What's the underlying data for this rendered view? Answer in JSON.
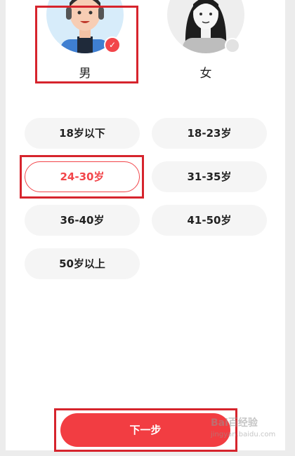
{
  "gender": {
    "male_label": "男",
    "female_label": "女",
    "selected": "male"
  },
  "age_options": [
    {
      "label": "18岁以下",
      "selected": false
    },
    {
      "label": "18-23岁",
      "selected": false
    },
    {
      "label": "24-30岁",
      "selected": true
    },
    {
      "label": "31-35岁",
      "selected": false
    },
    {
      "label": "36-40岁",
      "selected": false
    },
    {
      "label": "41-50岁",
      "selected": false
    },
    {
      "label": "50岁以上",
      "selected": false
    }
  ],
  "footer": {
    "next_label": "下一步"
  },
  "watermark": {
    "brand": "Bai百经验",
    "url": "jingyan.baidu.com"
  },
  "colors": {
    "accent": "#f23d42",
    "highlight_box": "#d6242d",
    "pill_bg": "#f5f5f5"
  }
}
